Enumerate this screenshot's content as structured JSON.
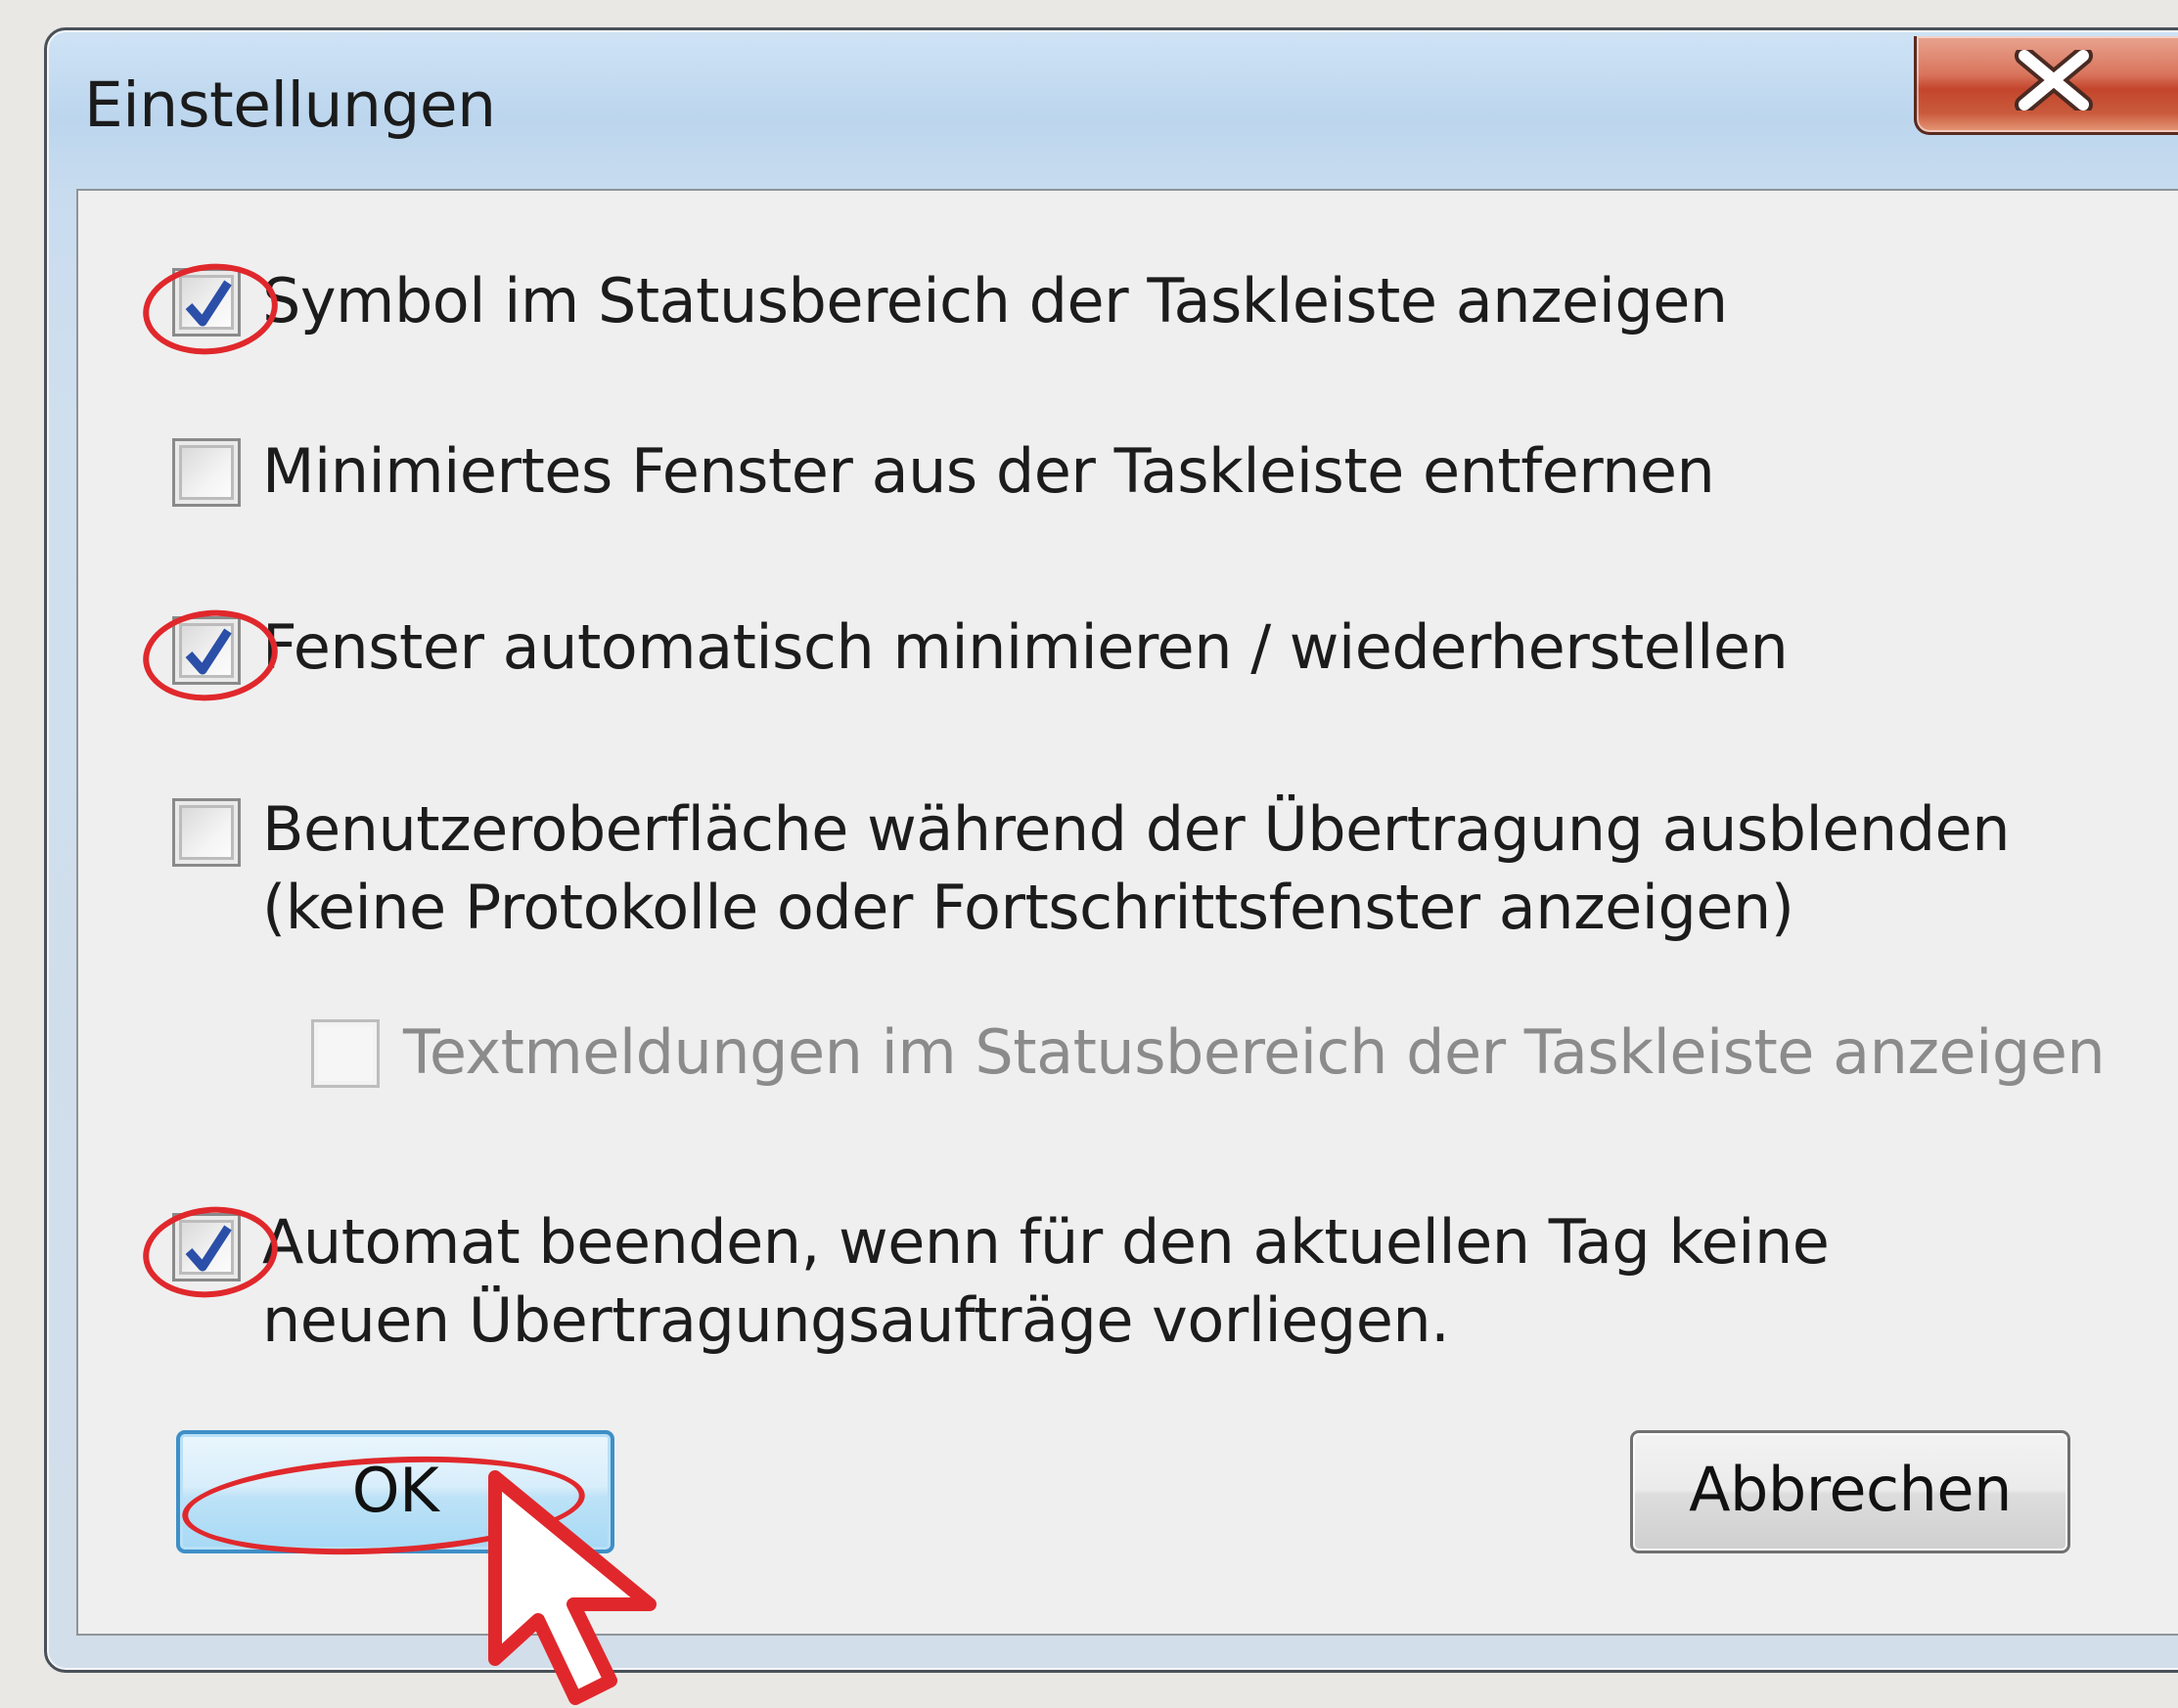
{
  "dialog": {
    "title": "Einstellungen",
    "close_icon": "close-x-icon"
  },
  "options": [
    {
      "label": "Symbol im Statusbereich der Taskleiste anzeigen",
      "checked": true,
      "enabled": true
    },
    {
      "label": "Minimiertes Fenster aus der Taskleiste entfernen",
      "checked": false,
      "enabled": true
    },
    {
      "label": "Fenster automatisch minimieren / wiederherstellen",
      "checked": true,
      "enabled": true
    },
    {
      "label_line1": "Benutzeroberfläche während der Übertragung ausblenden",
      "label_line2": "(keine Protokolle oder Fortschrittsfenster anzeigen)",
      "checked": false,
      "enabled": true
    },
    {
      "label": "Textmeldungen im Statusbereich der Taskleiste anzeigen",
      "checked": false,
      "enabled": false
    },
    {
      "label_line1": "Automat beenden, wenn für den aktuellen Tag keine",
      "label_line2": "neuen Übertragungsaufträge vorliegen.",
      "checked": true,
      "enabled": true
    }
  ],
  "buttons": {
    "ok_label": "OK",
    "cancel_label": "Abbrechen"
  },
  "colors": {
    "annotation_red": "#e0282c",
    "check_blue": "#2b4fa8"
  }
}
